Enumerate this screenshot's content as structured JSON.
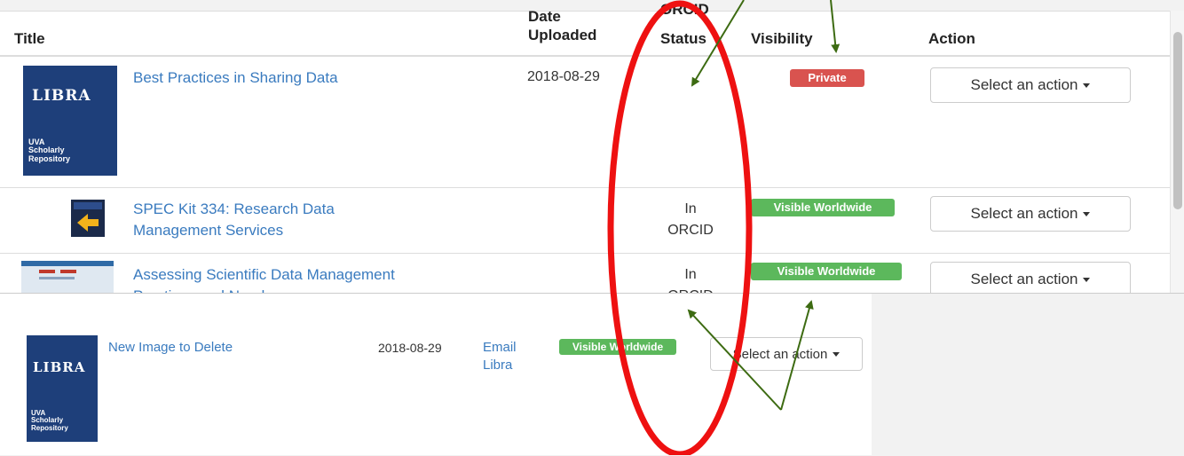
{
  "table": {
    "headers": {
      "title": "Title",
      "date_uploaded": "Date Uploaded",
      "date_line1": "Date",
      "date_line2": "Uploaded",
      "orcid_line1": "ORCID",
      "orcid_line2": "Status",
      "visibility": "Visibility",
      "action": "Action"
    },
    "rows": [
      {
        "title": "Best Practices in Sharing Data",
        "date": "2018-08-29",
        "orcid": "",
        "visibility": "Private",
        "action": "Select an action"
      },
      {
        "title_line1": "SPEC Kit 334: Research Data",
        "title_line2": "Management Services",
        "date": "",
        "orcid_line1": "In",
        "orcid_line2": "ORCID",
        "visibility": "Visible Worldwide",
        "action": "Select an action"
      },
      {
        "title_line1": "Assessing Scientific Data Management",
        "title_line2": "Practices and Needs",
        "date": "",
        "orcid_line1": "In",
        "orcid_line2": "ORCID",
        "visibility": "Visible Worldwide",
        "action": "Select an action"
      }
    ]
  },
  "thumbnail": {
    "brand": "LIBRA",
    "sub_line1": "UVA",
    "sub_line2": "Scholarly",
    "sub_line3": "Repository"
  },
  "lower_row": {
    "title": "New Image to Delete",
    "date": "2018-08-29",
    "orcid_line1": "Email",
    "orcid_line2": "Libra",
    "visibility": "Visible Worldwide",
    "action": "Select an action"
  },
  "colors": {
    "link": "#3a7bbf",
    "private_badge": "#d9534f",
    "visible_badge": "#5cb85c",
    "annotation_ellipse": "#ee1111",
    "annotation_arrow": "#3d6b12",
    "thumbnail_bg": "#1e3f7a"
  },
  "icons": {
    "caret": "caret-down-icon",
    "arrow": "annotation-arrow"
  }
}
